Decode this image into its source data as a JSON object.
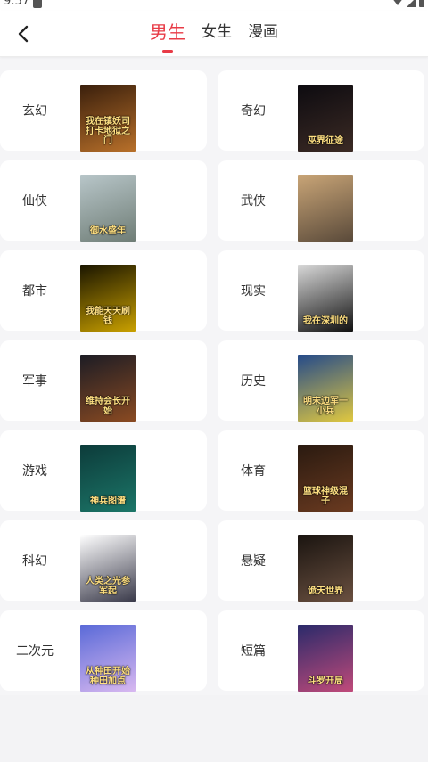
{
  "status_bar": {
    "time": "9:57"
  },
  "header": {
    "tabs": [
      {
        "label": "男生",
        "active": true
      },
      {
        "label": "女生",
        "active": false
      },
      {
        "label": "漫画",
        "active": false
      }
    ]
  },
  "accent_color": "#e83b46",
  "categories": [
    {
      "label": "玄幻",
      "cover_text": "我在镇妖司打卡地狱之门",
      "cover_colors": [
        "#3a1f0c",
        "#b8702a"
      ]
    },
    {
      "label": "奇幻",
      "cover_text": "巫界征途",
      "cover_colors": [
        "#0d0b10",
        "#3b2a24"
      ]
    },
    {
      "label": "仙侠",
      "cover_text": "御水盛年",
      "cover_colors": [
        "#b8c6c9",
        "#6f7d76"
      ]
    },
    {
      "label": "武侠",
      "cover_text": "",
      "cover_colors": [
        "#c9a577",
        "#5a4a3a"
      ]
    },
    {
      "label": "都市",
      "cover_text": "我能天天刷钱",
      "cover_colors": [
        "#1a1500",
        "#c9a000"
      ]
    },
    {
      "label": "现实",
      "cover_text": "我在深圳的",
      "cover_colors": [
        "#d9d9d9",
        "#111111"
      ]
    },
    {
      "label": "军事",
      "cover_text": "维持会长开始",
      "cover_colors": [
        "#1c1c24",
        "#8a4a22"
      ]
    },
    {
      "label": "历史",
      "cover_text": "明末边军一小兵",
      "cover_colors": [
        "#244a8a",
        "#e0c840"
      ]
    },
    {
      "label": "游戏",
      "cover_text": "神兵图谱",
      "cover_colors": [
        "#0c3b3a",
        "#1c7668"
      ]
    },
    {
      "label": "体育",
      "cover_text": "篮球神级混子",
      "cover_colors": [
        "#2a1a10",
        "#6a3a20"
      ]
    },
    {
      "label": "科幻",
      "cover_text": "人类之光参军起",
      "cover_colors": [
        "#ffffff",
        "#3a3a4a"
      ]
    },
    {
      "label": "悬疑",
      "cover_text": "诡天世界",
      "cover_colors": [
        "#1a1410",
        "#6a5040"
      ]
    },
    {
      "label": "二次元",
      "cover_text": "从种田开始种田加点",
      "cover_colors": [
        "#5a6ad8",
        "#d8b8f0"
      ]
    },
    {
      "label": "短篇",
      "cover_text": "斗罗开局",
      "cover_colors": [
        "#2a2a6a",
        "#c04a7a"
      ]
    }
  ]
}
